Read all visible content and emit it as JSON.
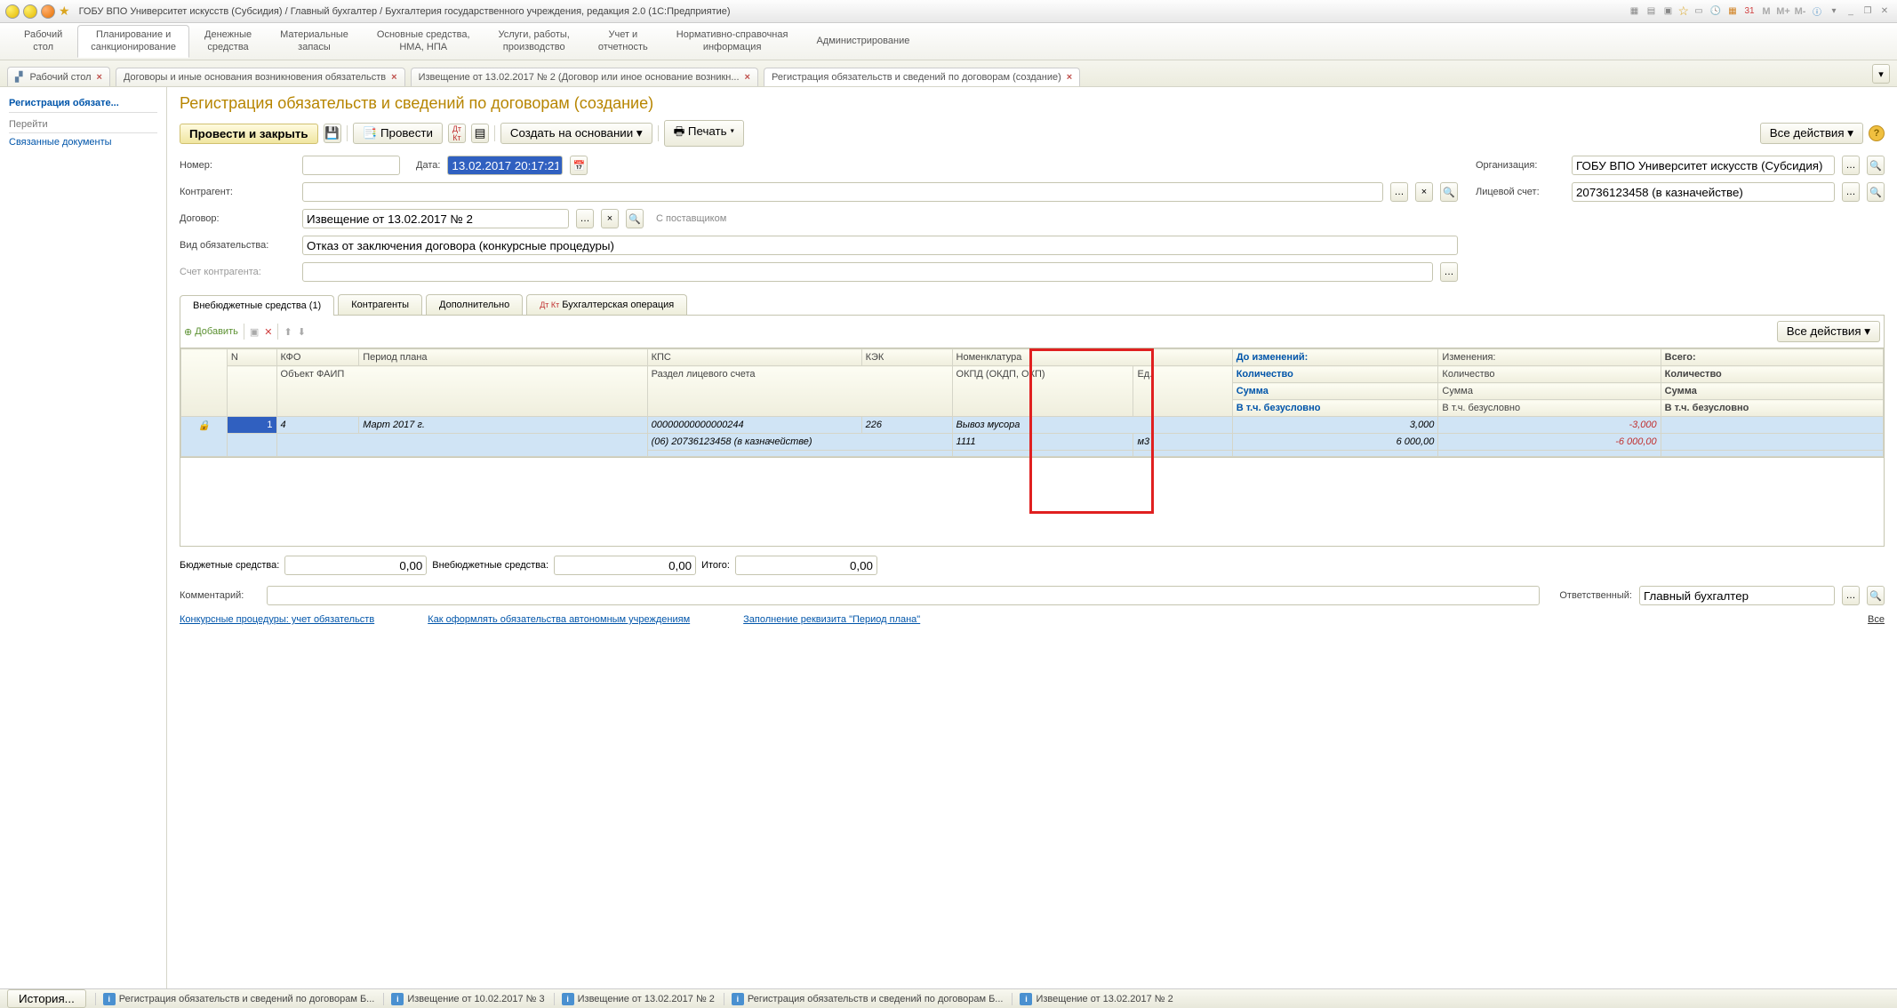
{
  "titlebar": {
    "title": "ГОБУ ВПО Университет искусств (Субсидия) / Главный бухгалтер / Бухгалтерия государственного учреждения, редакция 2.0  (1С:Предприятие)",
    "right_icons": [
      "M",
      "M+",
      "M-"
    ]
  },
  "topnav": [
    {
      "l1": "Рабочий",
      "l2": "стол"
    },
    {
      "l1": "Планирование и",
      "l2": "санкционирование"
    },
    {
      "l1": "Денежные",
      "l2": "средства"
    },
    {
      "l1": "Материальные",
      "l2": "запасы"
    },
    {
      "l1": "Основные средства,",
      "l2": "НМА, НПА"
    },
    {
      "l1": "Услуги, работы,",
      "l2": "производство"
    },
    {
      "l1": "Учет и",
      "l2": "отчетность"
    },
    {
      "l1": "Нормативно-справочная",
      "l2": "информация"
    },
    {
      "l1": "Администрирование",
      "l2": ""
    }
  ],
  "tabs": [
    {
      "label": "Рабочий стол",
      "icon": true
    },
    {
      "label": "Договоры и иные основания возникновения обязательств"
    },
    {
      "label": "Извещение от 13.02.2017 № 2 (Договор или иное основание возникн..."
    },
    {
      "label": "Регистрация обязательств и сведений по договорам (создание)",
      "active": true
    }
  ],
  "sidebar": {
    "header": "Регистрация обязате...",
    "section": "Перейти",
    "link": "Связанные документы"
  },
  "page_title": "Регистрация обязательств и сведений по договорам (создание)",
  "toolbar": {
    "post_close": "Провести и закрыть",
    "post": "Провести",
    "create_based": "Создать на основании",
    "print": "Печать",
    "all_actions": "Все действия"
  },
  "form": {
    "number_label": "Номер:",
    "number_value": "",
    "date_label": "Дата:",
    "date_value": "13.02.2017 20:17:21",
    "org_label": "Организация:",
    "org_value": "ГОБУ ВПО Университет искусств (Субсидия)",
    "contr_label": "Контрагент:",
    "contr_value": "",
    "account_label": "Лицевой счет:",
    "account_value": "20736123458 (в казначействе)",
    "contract_label": "Договор:",
    "contract_value": "Извещение от 13.02.2017 № 2",
    "contract_hint": "С поставщиком",
    "kind_label": "Вид обязательства:",
    "kind_value": "Отказ от заключения договора (конкурсные процедуры)",
    "contr_acc_label": "Счет контрагента:",
    "contr_acc_value": ""
  },
  "tabs2": [
    {
      "label": "Внебюджетные средства (1)",
      "active": true
    },
    {
      "label": "Контрагенты"
    },
    {
      "label": "Дополнительно"
    },
    {
      "label": "Бухгалтерская операция",
      "ak": true
    }
  ],
  "gridbar": {
    "add": "Добавить",
    "all_actions": "Все действия"
  },
  "grid": {
    "headers": {
      "n": "N",
      "kfo": "КФО",
      "period": "Период плана",
      "kps": "КПС",
      "kek": "КЭК",
      "nomen": "Номенклатура",
      "before": "До изменений:",
      "changes": "Изменения:",
      "total": "Всего:",
      "faip": "Объект ФАИП",
      "section": "Раздел лицевого счета",
      "okpd": "ОКПД (ОКДП, ОКП)",
      "unit": "Ед.",
      "qty": "Количество",
      "sum": "Сумма",
      "uncond": "В т.ч. безусловно"
    },
    "row": {
      "n": "1",
      "kfo": "4",
      "period": "Март 2017 г.",
      "kps": "00000000000000244",
      "kek": "226",
      "nomen": "Вывоз мусора",
      "before_qty": "3,000",
      "change_qty": "-3,000",
      "section": "(06) 20736123458 (в казначействе)",
      "okpd": "1111",
      "unit": "м3",
      "before_sum": "6 000,00",
      "change_sum": "-6 000,00"
    }
  },
  "totals": {
    "budget_label": "Бюджетные средства:",
    "budget_value": "0,00",
    "offbudget_label": "Внебюджетные средства:",
    "offbudget_value": "0,00",
    "total_label": "Итого:",
    "total_value": "0,00"
  },
  "comment": {
    "label": "Комментарий:",
    "value": ""
  },
  "responsible": {
    "label": "Ответственный:",
    "value": "Главный бухгалтер"
  },
  "links": {
    "l1": "Конкурсные процедуры: учет обязательств",
    "l2": "Как оформлять обязательства автономным учреждениям",
    "l3": "Заполнение реквизита \"Период плана\"",
    "all": "Все"
  },
  "statusbar": {
    "history": "История...",
    "items": [
      "Регистрация обязательств и сведений по договорам Б...",
      "Извещение от 10.02.2017 № 3",
      "Извещение от 13.02.2017 № 2",
      "Регистрация обязательств и сведений по договорам Б...",
      "Извещение от 13.02.2017 № 2"
    ]
  }
}
